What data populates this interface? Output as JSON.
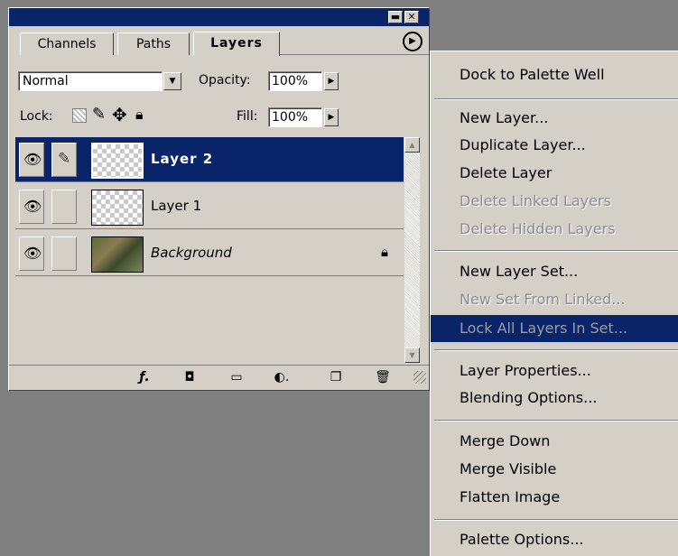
{
  "palette": {
    "tabs": [
      {
        "label": "Channels"
      },
      {
        "label": "Paths"
      },
      {
        "label": "Layers"
      }
    ],
    "titlebar_buttons": {
      "minimize": "▬",
      "close": "✕"
    },
    "blend_mode": "Normal",
    "opacity_label": "Opacity:",
    "opacity_value": "100%",
    "lock_label": "Lock:",
    "fill_label": "Fill:",
    "fill_value": "100%",
    "layers": [
      {
        "name": "Layer 2",
        "selected": true,
        "thumb": "transparent",
        "paint_icon": "brush-icon"
      },
      {
        "name": "Layer 1",
        "selected": false,
        "thumb": "transparent"
      },
      {
        "name": "Background",
        "selected": false,
        "thumb": "photo",
        "locked": true
      }
    ],
    "bottom_icons": [
      "layer-style-icon",
      "mask-icon",
      "folder-icon",
      "adjustment-layer-icon",
      "new-layer-icon",
      "trash-icon"
    ]
  },
  "menu": {
    "items": [
      {
        "label": "Dock to Palette Well",
        "state": "enabled"
      },
      {
        "label": "New Layer...",
        "state": "enabled"
      },
      {
        "label": "Duplicate Layer...",
        "state": "enabled"
      },
      {
        "label": "Delete Layer",
        "state": "enabled"
      },
      {
        "label": "Delete Linked Layers",
        "state": "disabled"
      },
      {
        "label": "Delete Hidden Layers",
        "state": "disabled"
      },
      {
        "label": "New Layer Set...",
        "state": "enabled"
      },
      {
        "label": "New Set From Linked...",
        "state": "disabled"
      },
      {
        "label": "Lock All Layers In Set...",
        "state": "highlighted-disabled"
      },
      {
        "label": "Layer Properties...",
        "state": "enabled"
      },
      {
        "label": "Blending Options...",
        "state": "enabled"
      },
      {
        "label": "Merge Down",
        "state": "enabled"
      },
      {
        "label": "Merge Visible",
        "state": "enabled"
      },
      {
        "label": "Flatten Image",
        "state": "enabled"
      },
      {
        "label": "Palette Options...",
        "state": "enabled"
      }
    ]
  },
  "colors": {
    "titlebar": "#0a246a",
    "selection": "#0a246a",
    "panel": "#d4d0c8",
    "background": "#808080"
  }
}
